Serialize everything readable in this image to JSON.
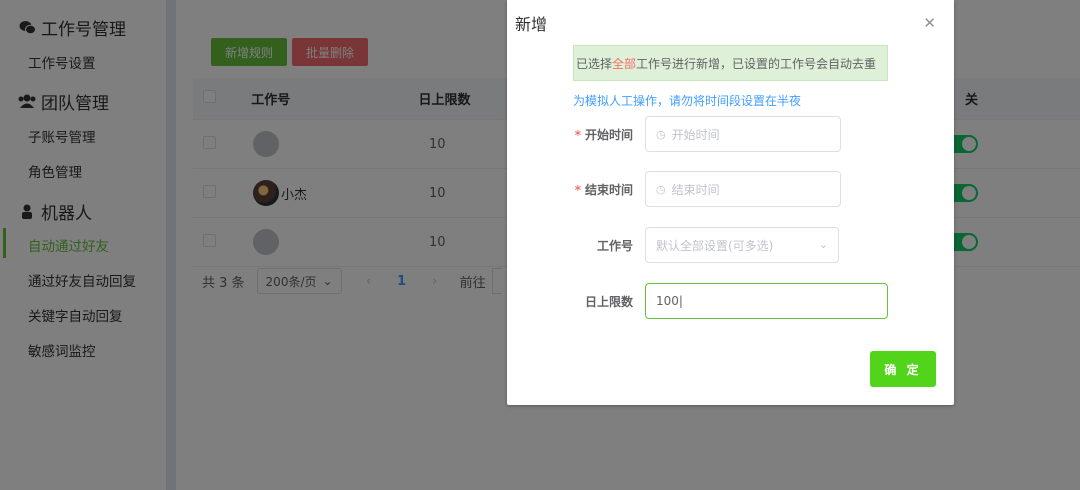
{
  "sidebar": {
    "groups": [
      {
        "label": "工作号管理",
        "icon": "wechat-icon",
        "items": [
          {
            "label": "工作号设置"
          }
        ]
      },
      {
        "label": "团队管理",
        "icon": "team-icon",
        "items": [
          {
            "label": "子账号管理"
          },
          {
            "label": "角色管理"
          }
        ]
      },
      {
        "label": "机器人",
        "icon": "robot-icon",
        "items": [
          {
            "label": "自动通过好友",
            "active": true
          },
          {
            "label": "通过好友自动回复"
          },
          {
            "label": "关键字自动回复"
          },
          {
            "label": "敏感词监控"
          }
        ]
      }
    ]
  },
  "toolbar": {
    "add_label": "新增规则",
    "batch_delete_label": "批量删除"
  },
  "table": {
    "columns": [
      "工作号",
      "日上限数",
      "关"
    ],
    "rows": [
      {
        "account": "",
        "daily_limit": "10",
        "enabled": true
      },
      {
        "account": "小杰",
        "daily_limit": "10",
        "enabled": true
      },
      {
        "account": "",
        "daily_limit": "10",
        "enabled": true
      }
    ]
  },
  "pagination": {
    "total": "共 3 条",
    "page_size": "200条/页",
    "current_page": "1",
    "goto": "前往"
  },
  "dialog": {
    "title": "新增",
    "notice_prefix": "已选择",
    "notice_highlight": "全部",
    "notice_suffix": "工作号进行新增，已设置的工作号会自动去重",
    "hint": "为模拟人工操作，请勿将时间段设置在半夜",
    "start_time": {
      "label": "开始时间",
      "placeholder": "开始时间",
      "required": true
    },
    "end_time": {
      "label": "结束时间",
      "placeholder": "结束时间",
      "required": true
    },
    "account": {
      "label": "工作号",
      "placeholder": "默认全部设置(可多选)"
    },
    "daily_limit": {
      "label": "日上限数",
      "value": "100"
    },
    "confirm_label": "确 定"
  },
  "colors": {
    "accent": "#67c23a",
    "danger": "#f56c6c",
    "link": "#409eff",
    "switch_on": "#13ce66"
  }
}
